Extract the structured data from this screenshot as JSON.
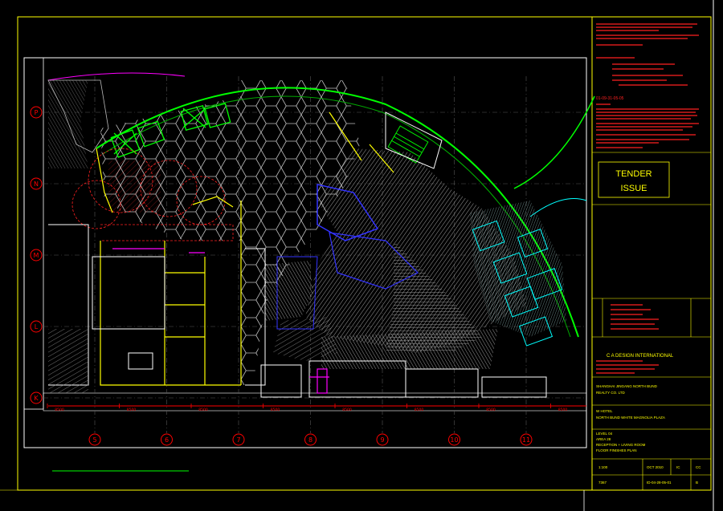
{
  "drawing": {
    "grid_rows": [
      "P",
      "N",
      "M",
      "L",
      "K"
    ],
    "grid_cols": [
      "5",
      "6",
      "7",
      "8",
      "9",
      "10",
      "11"
    ],
    "dimensions": [
      "8500",
      "8500",
      "8500",
      "8500",
      "8500",
      "8500",
      "8500",
      "8500"
    ]
  },
  "title_block": {
    "tender_line1": "TENDER",
    "tender_line2": "ISSUE",
    "revision_code": "01-09-31-05-05",
    "company": "C A DESIGN INTERNATIONAL",
    "client_line1": "SHANGHAI JINGANG NORTH BUND",
    "client_line2": "REALTY CO. LTD",
    "project_line1": "W HOTEL",
    "project_line2": "NORTH BUND WHITE MAGNOLIA PLAZA",
    "sheet_line1": "LEVEL 04",
    "sheet_line2": "AREA 28",
    "sheet_line3": "RECEPTION + LIVING ROOM",
    "sheet_line4": "FLOOR FINISHES PLAN",
    "scale": "1:100",
    "date": "OCT 2010",
    "drawn": "IC",
    "checked": "CC",
    "job_no": "7367",
    "drawing_no": "ID-04-28-05-01",
    "rev": "B"
  },
  "colors": {
    "frame": "#ffff00",
    "grid": "#6a6a6a",
    "wall": "#ffffff",
    "green": "#00ff00",
    "cyan": "#00ffff",
    "blue": "#2a2aff",
    "red": "#ff0000",
    "magenta": "#ff00ff",
    "hatch": "#9a9a9a"
  }
}
